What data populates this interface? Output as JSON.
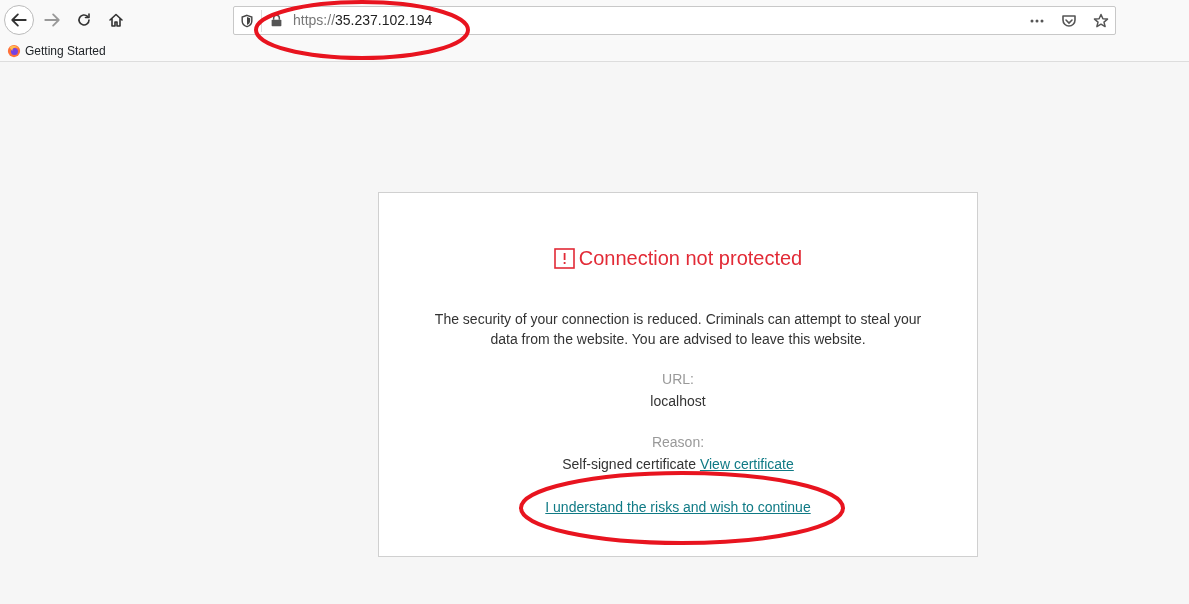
{
  "address_bar": {
    "scheme": "https://",
    "host": "35.237.102.194"
  },
  "bookmarks": [
    {
      "label": "Getting Started"
    }
  ],
  "error_page": {
    "title": "Connection not protected",
    "message": "The security of your connection is reduced. Criminals can attempt to steal your data from the website. You are advised to leave this website.",
    "url_label": "URL:",
    "url_value": "localhost",
    "reason_label": "Reason:",
    "reason_value": "Self-signed certificate",
    "view_certificate_link": "View certificate",
    "continue_link": "I understand the risks and wish to continue"
  }
}
